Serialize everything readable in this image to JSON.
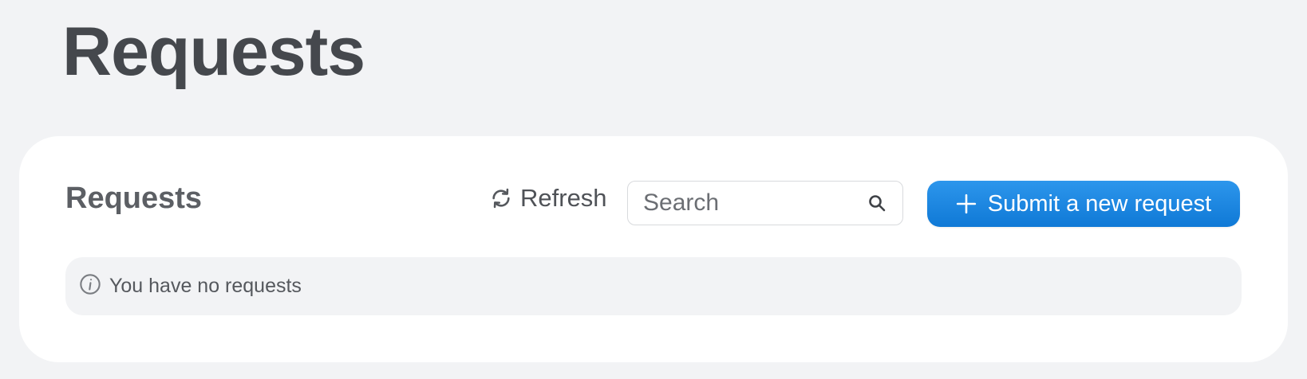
{
  "page": {
    "title": "Requests"
  },
  "requests_card": {
    "title": "Requests",
    "refresh_label": "Refresh",
    "search": {
      "placeholder": "Search",
      "value": ""
    },
    "submit_label": "Submit a new request",
    "empty_message": "You have no requests"
  },
  "icons": {
    "refresh": "refresh-icon",
    "search": "search-icon",
    "plus": "plus-icon",
    "info": "info-icon"
  },
  "colors": {
    "page_background": "#f2f3f5",
    "card_background": "#ffffff",
    "primary_button": "#1d87e3",
    "primary_button_text": "#ffffff",
    "empty_state_background": "#f2f3f5"
  }
}
